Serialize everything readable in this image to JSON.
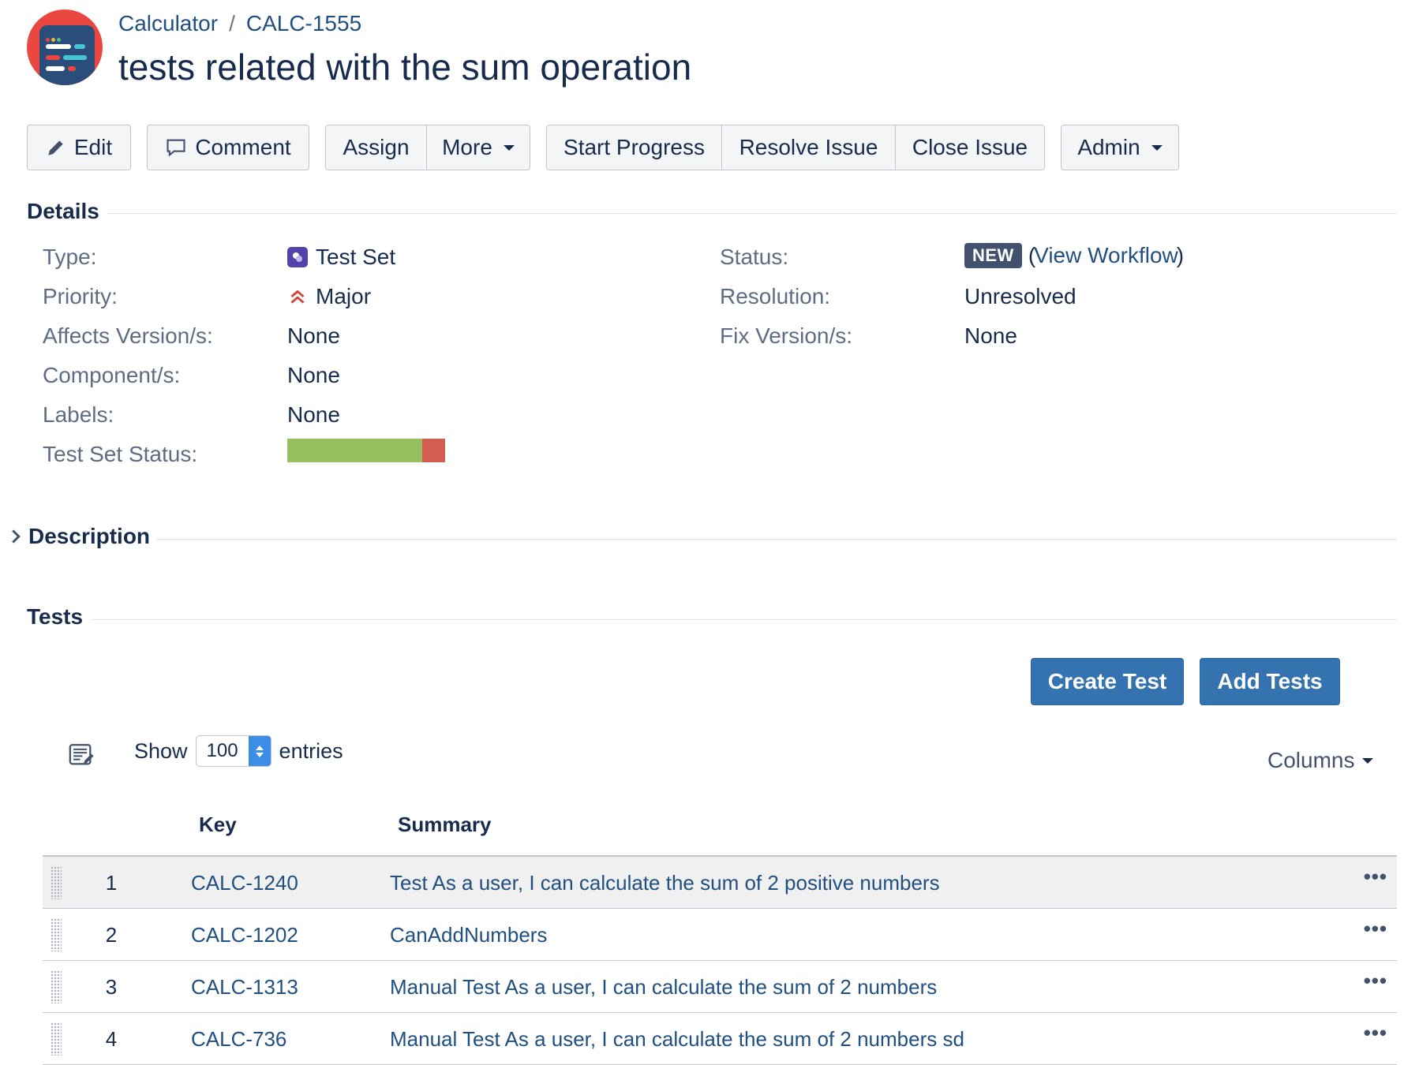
{
  "header": {
    "breadcrumb_project": "Calculator",
    "breadcrumb_sep": "/",
    "breadcrumb_issue": "CALC-1555",
    "title": "tests related with the sum operation"
  },
  "toolbar": {
    "edit": "Edit",
    "comment": "Comment",
    "assign": "Assign",
    "more": "More",
    "start_progress": "Start Progress",
    "resolve_issue": "Resolve Issue",
    "close_issue": "Close Issue",
    "admin": "Admin"
  },
  "details": {
    "heading": "Details",
    "type_label": "Type:",
    "type_value": "Test Set",
    "priority_label": "Priority:",
    "priority_value": "Major",
    "affects_label": "Affects Version/s:",
    "affects_value": "None",
    "component_label": "Component/s:",
    "component_value": "None",
    "labels_label": "Labels:",
    "labels_value": "None",
    "test_set_status_label": "Test Set Status:",
    "test_set_status": {
      "pass_fraction": 0.857,
      "fail_fraction": 0.143,
      "pass_color": "#95c160",
      "fail_color": "#d45d52"
    },
    "status_label": "Status:",
    "status_value": "NEW",
    "view_workflow_open": "(",
    "view_workflow": "View Workflow",
    "view_workflow_close": ")",
    "resolution_label": "Resolution:",
    "resolution_value": "Unresolved",
    "fix_label": "Fix Version/s:",
    "fix_value": "None"
  },
  "description": {
    "heading": "Description"
  },
  "tests": {
    "heading": "Tests",
    "create_test": "Create Test",
    "add_tests": "Add Tests",
    "show_label": "Show",
    "entries_value": "100",
    "entries_label": "entries",
    "columns": "Columns",
    "col_key": "Key",
    "col_summary": "Summary",
    "rows": [
      {
        "num": "1",
        "key": "CALC-1240",
        "summary": "Test As a user, I can calculate the sum of 2 positive numbers"
      },
      {
        "num": "2",
        "key": "CALC-1202",
        "summary": "CanAddNumbers"
      },
      {
        "num": "3",
        "key": "CALC-1313",
        "summary": "Manual Test As a user, I can calculate the sum of 2 numbers"
      },
      {
        "num": "4",
        "key": "CALC-736",
        "summary": "Manual Test As a user, I can calculate the sum of 2 numbers sd"
      }
    ],
    "row_menu": "•••"
  },
  "colors": {
    "accent": "#3572b0",
    "link": "#205081",
    "avatar_bg": "#e9473f"
  }
}
